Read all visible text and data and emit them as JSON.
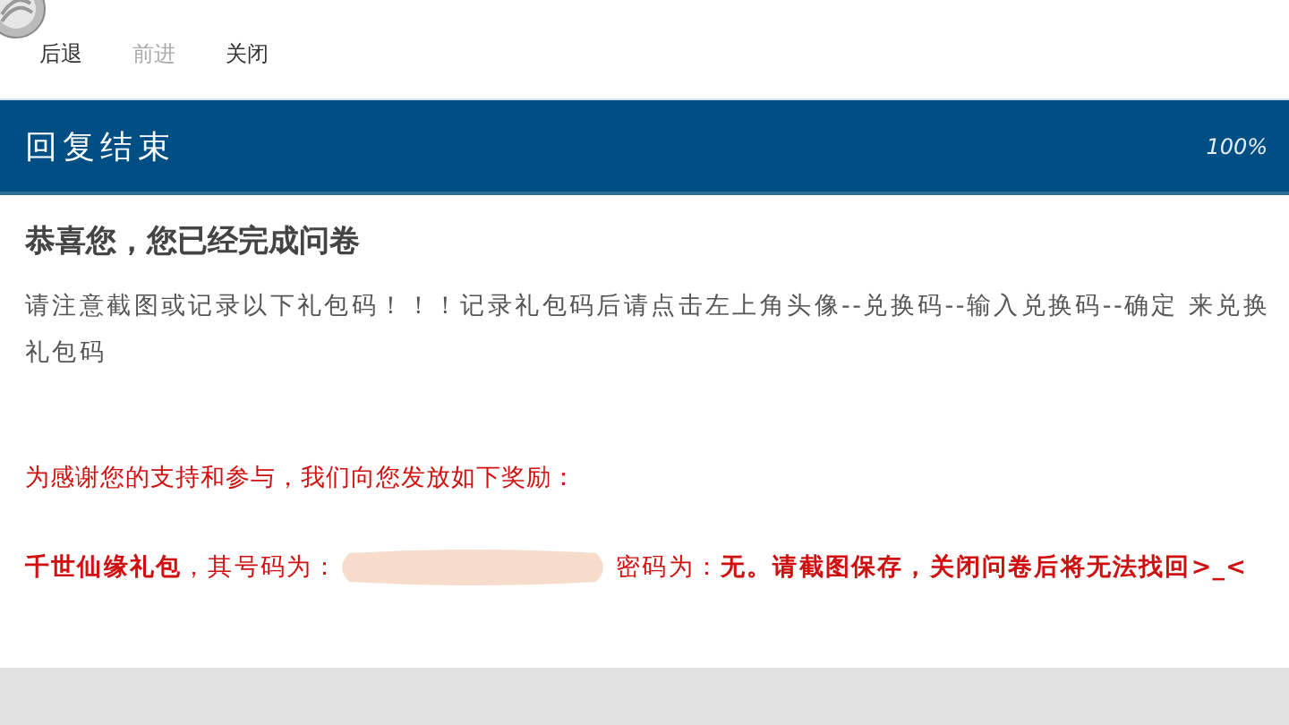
{
  "nav": [
    {
      "label": "后退",
      "disabled": false
    },
    {
      "label": "前进",
      "disabled": true
    },
    {
      "label": "关闭",
      "disabled": false
    }
  ],
  "header": {
    "title": "回复结束",
    "progress": "100%"
  },
  "heading": "恭喜您，您已经完成问卷",
  "instructions": "请注意截图或记录以下礼包码！！！记录礼包码后请点击左上角头像--兑换码--输入兑换码--确定 来兑换礼包码",
  "thanks": "为感谢您的支持和参与，我们向您发放如下奖励：",
  "reward": {
    "before": "**千世仙缘礼包**，其号码为：",
    "code_redacted": true,
    "after": "密码为：**无。请截图保存，关闭问卷后将无法找回>_<**"
  }
}
